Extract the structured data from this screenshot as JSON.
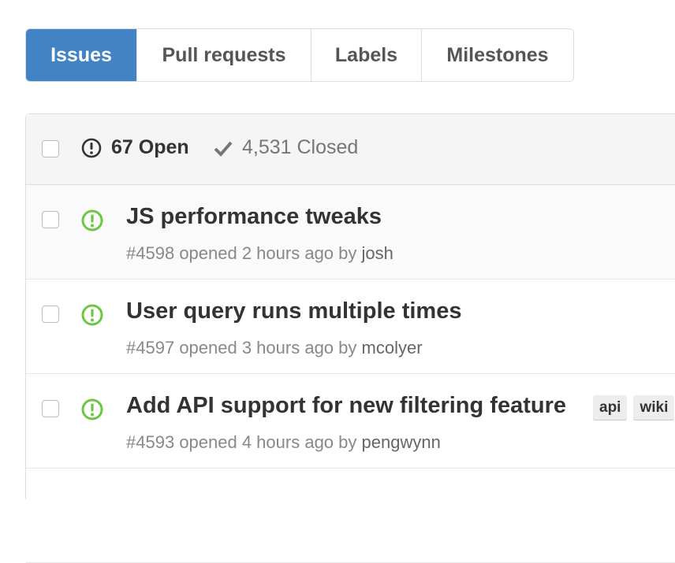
{
  "nav": {
    "tabs": [
      {
        "label": "Issues",
        "selected": true
      },
      {
        "label": "Pull requests",
        "selected": false
      },
      {
        "label": "Labels",
        "selected": false
      },
      {
        "label": "Milestones",
        "selected": false
      }
    ]
  },
  "states": {
    "open_label": "67 Open",
    "closed_label": "4,531 Closed",
    "open_icon": "issue-opened-icon",
    "closed_icon": "check-icon"
  },
  "issues": [
    {
      "title": "JS performance tweaks",
      "number": "#4598",
      "opened_text": "opened 2 hours ago by",
      "author": "josh",
      "labels": []
    },
    {
      "title": "User query runs multiple times",
      "number": "#4597",
      "opened_text": "opened 3 hours ago by",
      "author": "mcolyer",
      "labels": []
    },
    {
      "title": "Add API support for new filtering feature",
      "number": "#4593",
      "opened_text": "opened 4 hours ago by",
      "author": "pengwynn",
      "labels": [
        "api",
        "wiki"
      ]
    }
  ],
  "colors": {
    "accent": "#4183c4",
    "open_icon": "#6cc644",
    "header_bg": "#f5f5f5",
    "muted_text": "#888888"
  }
}
